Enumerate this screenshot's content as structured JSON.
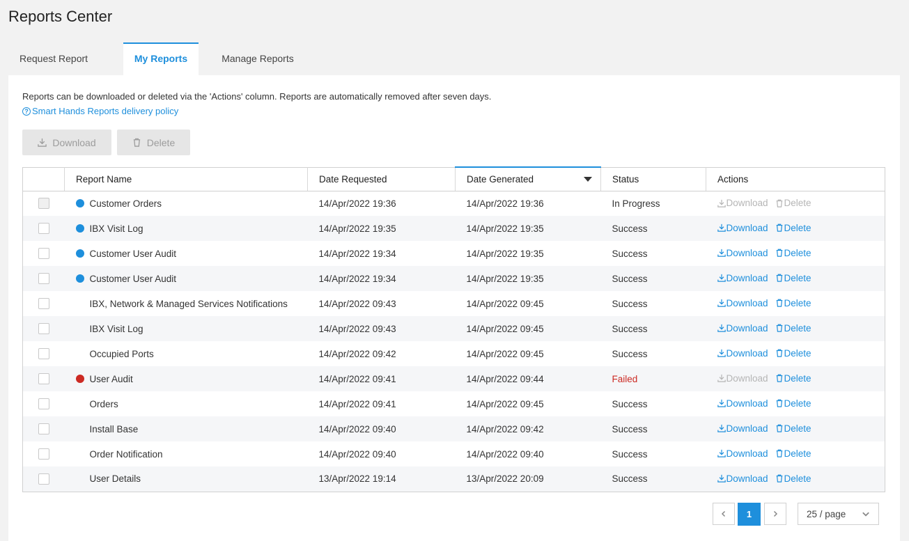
{
  "title": "Reports Center",
  "tabs": [
    {
      "label": "Request Report"
    },
    {
      "label": "My Reports"
    },
    {
      "label": "Manage Reports"
    }
  ],
  "info": {
    "text": "Reports can be downloaded or deleted via the 'Actions' column. Reports are automatically removed after seven days.",
    "policy_link": "Smart Hands Reports delivery policy"
  },
  "toolbar": {
    "download_label": "Download",
    "delete_label": "Delete"
  },
  "table": {
    "headers": [
      "Report Name",
      "Date Requested",
      "Date Generated",
      "Status",
      "Actions"
    ],
    "action_download": "Download",
    "action_delete": "Delete",
    "rows": [
      {
        "name": "Customer Orders",
        "requested": "14/Apr/2022 19:36",
        "generated": "14/Apr/2022 19:36",
        "status": "In Progress"
      },
      {
        "name": "IBX Visit Log",
        "requested": "14/Apr/2022 19:35",
        "generated": "14/Apr/2022 19:35",
        "status": "Success"
      },
      {
        "name": "Customer User Audit",
        "requested": "14/Apr/2022 19:34",
        "generated": "14/Apr/2022 19:35",
        "status": "Success"
      },
      {
        "name": "Customer User Audit",
        "requested": "14/Apr/2022 19:34",
        "generated": "14/Apr/2022 19:35",
        "status": "Success"
      },
      {
        "name": "IBX, Network & Managed Services Notifications",
        "requested": "14/Apr/2022 09:43",
        "generated": "14/Apr/2022 09:45",
        "status": "Success"
      },
      {
        "name": "IBX Visit Log",
        "requested": "14/Apr/2022 09:43",
        "generated": "14/Apr/2022 09:45",
        "status": "Success"
      },
      {
        "name": "Occupied Ports",
        "requested": "14/Apr/2022 09:42",
        "generated": "14/Apr/2022 09:45",
        "status": "Success"
      },
      {
        "name": "User Audit",
        "requested": "14/Apr/2022 09:41",
        "generated": "14/Apr/2022 09:44",
        "status": "Failed"
      },
      {
        "name": "Orders",
        "requested": "14/Apr/2022 09:41",
        "generated": "14/Apr/2022 09:45",
        "status": "Success"
      },
      {
        "name": "Install Base",
        "requested": "14/Apr/2022 09:40",
        "generated": "14/Apr/2022 09:42",
        "status": "Success"
      },
      {
        "name": "Order Notification",
        "requested": "14/Apr/2022 09:40",
        "generated": "14/Apr/2022 09:40",
        "status": "Success"
      },
      {
        "name": "User Details",
        "requested": "13/Apr/2022 19:14",
        "generated": "13/Apr/2022 20:09",
        "status": "Success"
      }
    ]
  },
  "pagination": {
    "current_page": "1",
    "page_size": "25 / page"
  },
  "colors": {
    "accent": "#1e8fdc",
    "failed": "#cc2a23",
    "new_dot": "#1e8fdc"
  }
}
